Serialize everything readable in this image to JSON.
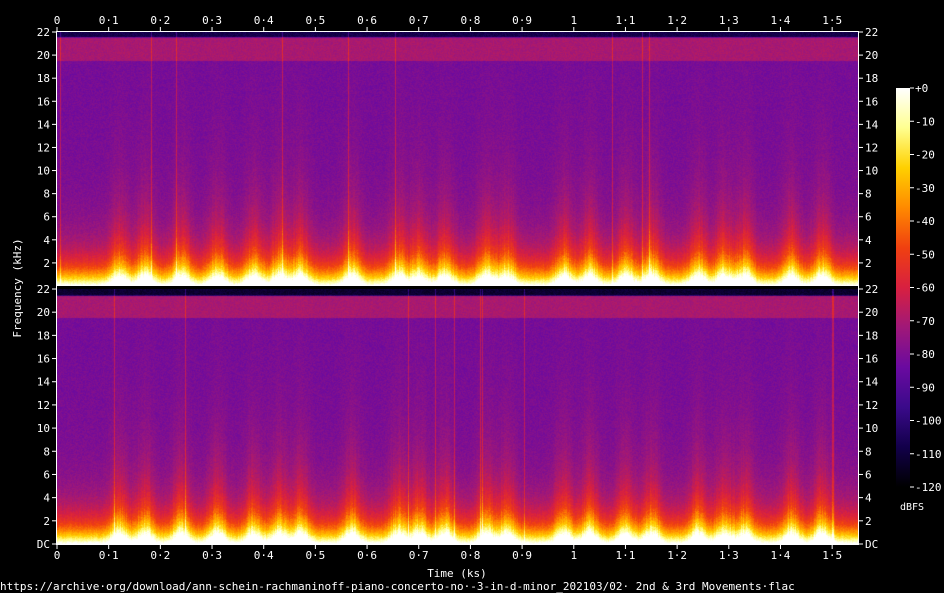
{
  "chart_data": {
    "type": "heatmap",
    "subtype": "spectrogram",
    "channels": 2,
    "xlabel": "Time (ks)",
    "ylabel": "Frequency (kHz)",
    "x_ticks": [
      "0",
      "0·1",
      "0·2",
      "0·3",
      "0·4",
      "0·5",
      "0·6",
      "0·7",
      "0·8",
      "0·9",
      "1",
      "1·1",
      "1·2",
      "1·3",
      "1·4",
      "1·5"
    ],
    "x_tick_values": [
      0,
      0.1,
      0.2,
      0.3,
      0.4,
      0.5,
      0.6,
      0.7,
      0.8,
      0.9,
      1.0,
      1.1,
      1.2,
      1.3,
      1.4,
      1.5
    ],
    "xlim": [
      0,
      1.55
    ],
    "y_ticks_top": [
      "22",
      "20",
      "18",
      "16",
      "14",
      "12",
      "10",
      "8",
      "6",
      "4",
      "2"
    ],
    "y_ticks_bottom": [
      "22",
      "20",
      "18",
      "16",
      "14",
      "12",
      "10",
      "8",
      "6",
      "4",
      "2",
      "DC"
    ],
    "y_tick_values": [
      22,
      20,
      18,
      16,
      14,
      12,
      10,
      8,
      6,
      4,
      2,
      0
    ],
    "ylim": [
      0,
      22
    ],
    "colorbar": {
      "label": "dBFS",
      "ticks": [
        "+0",
        "-10",
        "-20",
        "-30",
        "-40",
        "-50",
        "-60",
        "-70",
        "-80",
        "-90",
        "-100",
        "-110",
        "-120"
      ],
      "tick_values": [
        0,
        -10,
        -20,
        -30,
        -40,
        -50,
        -60,
        -70,
        -80,
        -90,
        -100,
        -110,
        -120
      ],
      "range": [
        -120,
        0
      ]
    },
    "activity_peaks_ks": [
      0.12,
      0.17,
      0.24,
      0.31,
      0.38,
      0.43,
      0.47,
      0.57,
      0.66,
      0.7,
      0.75,
      0.83,
      0.87,
      0.98,
      1.03,
      1.1,
      1.15,
      1.24,
      1.29,
      1.33,
      1.42,
      1.48
    ],
    "source_caption": "https://archive·org/download/ann-schein-rachmaninoff-piano-concerto-no·-3-in-d-minor_202103/02· 2nd & 3rd Movements·flac"
  },
  "colors": {
    "background": "#000000",
    "text": "#ffffff",
    "colormap": [
      "#000000",
      "#12004a",
      "#3a0a8a",
      "#6a0aa0",
      "#a01878",
      "#d82040",
      "#f04010",
      "#ff8a00",
      "#ffd000",
      "#ffff90",
      "#ffffff"
    ]
  }
}
